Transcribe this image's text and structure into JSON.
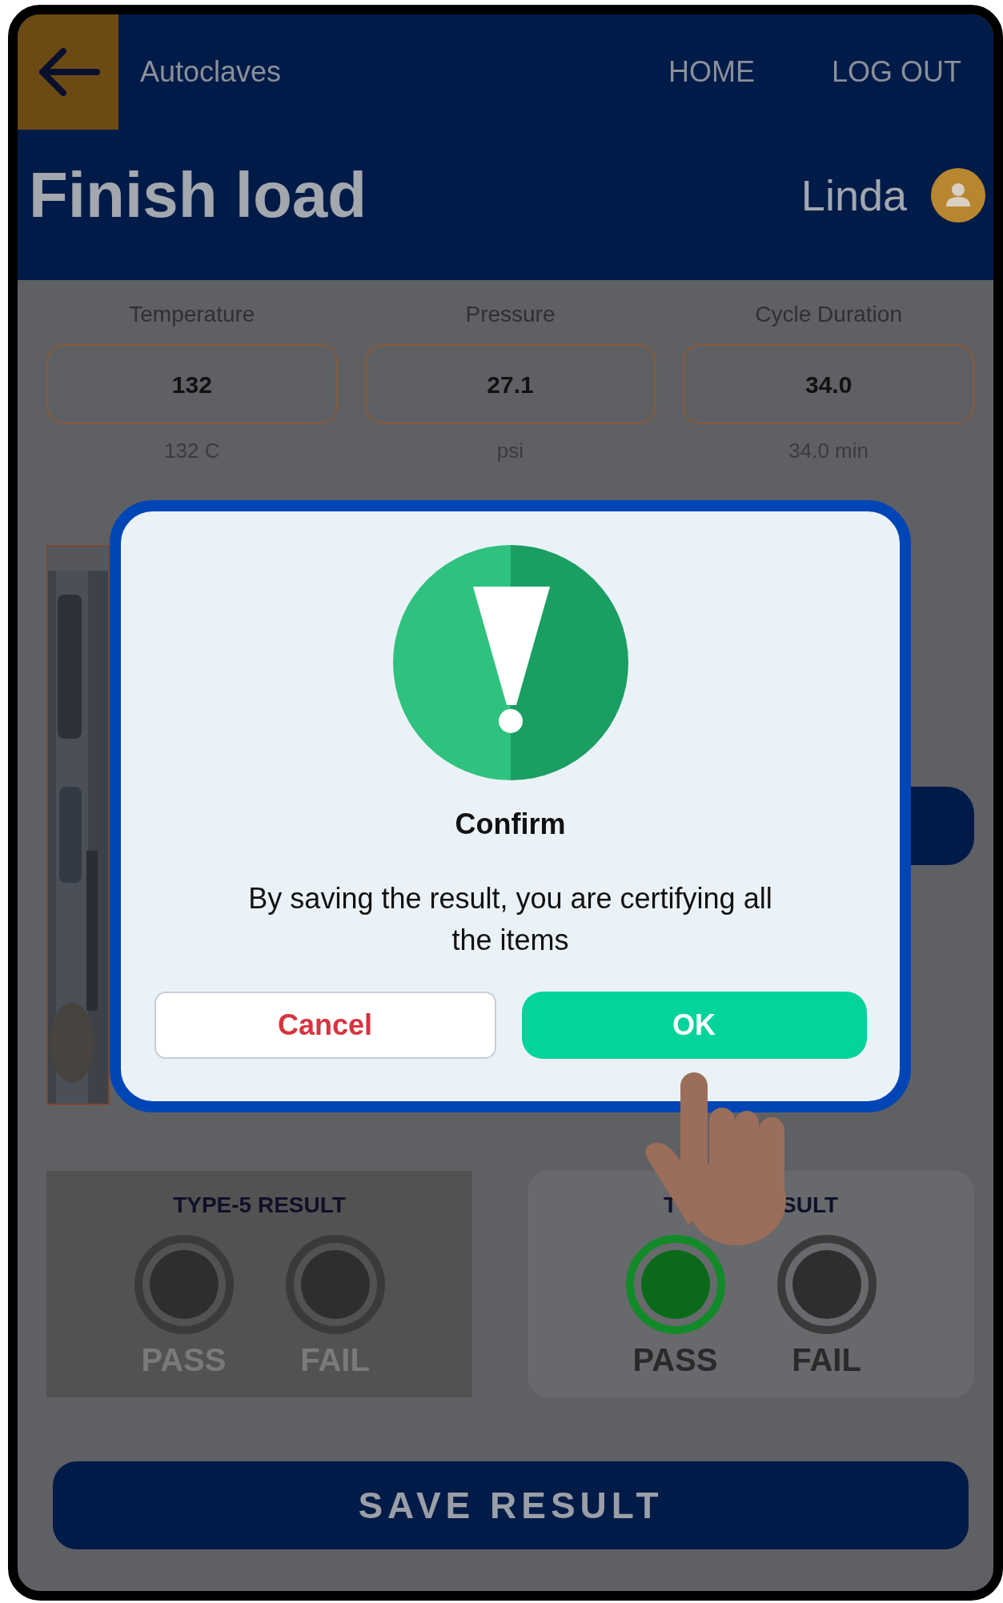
{
  "header": {
    "section": "Autoclaves",
    "nav": [
      "HOME",
      "LOG OUT"
    ],
    "title": "Finish load",
    "user": "Linda"
  },
  "readings": [
    {
      "label": "Temperature",
      "value": "132",
      "hint": "132 C"
    },
    {
      "label": "Pressure",
      "value": "27.1",
      "hint": "psi"
    },
    {
      "label": "Cycle Duration",
      "value": "34.0",
      "hint": "34.0 min"
    }
  ],
  "results": [
    {
      "heading_parts": [
        "TYPE-5 RESULT"
      ],
      "disabled": true,
      "options": [
        {
          "label": "PASS",
          "selected": false
        },
        {
          "label": "FAIL",
          "selected": false
        }
      ]
    },
    {
      "heading_parts": [
        "T",
        "SULT"
      ],
      "disabled": false,
      "options": [
        {
          "label": "PASS",
          "selected": true
        },
        {
          "label": "FAIL",
          "selected": false
        }
      ]
    }
  ],
  "save_button": "SAVE RESULT",
  "dialog": {
    "title": "Confirm",
    "message": "By saving the result, you are certifying all the items",
    "buttons": [
      {
        "label": "Cancel",
        "kind": "secondary"
      },
      {
        "label": "OK",
        "kind": "primary"
      }
    ]
  }
}
